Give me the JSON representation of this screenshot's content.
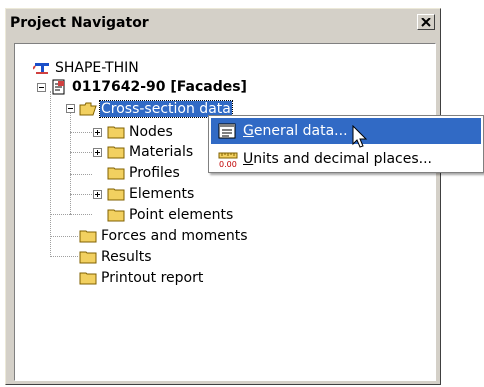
{
  "window": {
    "title": "Project Navigator"
  },
  "tree": {
    "root": "SHAPE-THIN",
    "project": "0117642-90 [Facades]",
    "cross_section": "Cross-section data",
    "nodes": "Nodes",
    "materials": "Materials",
    "profiles": "Profiles",
    "elements": "Elements",
    "point_elements": "Point elements",
    "forces": "Forces and moments",
    "results": "Results",
    "printout": "Printout report"
  },
  "context_menu": {
    "general_prefix": "",
    "general_mnemonic": "G",
    "general_rest": "eneral data...",
    "units_mnemonic": "U",
    "units_rest": "nits and decimal places..."
  },
  "colors": {
    "selection": "#316ac5",
    "folder": "#f2d060",
    "window_bg": "#d4d0c8"
  }
}
